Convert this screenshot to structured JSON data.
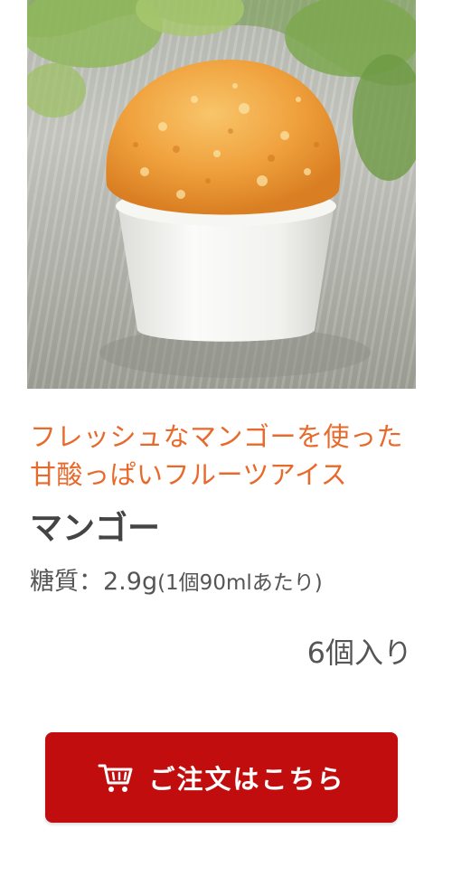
{
  "product": {
    "image_alt": "マンゴーアイス",
    "tagline": "フレッシュなマンゴーを使った甘酸っぱいフルーツアイス",
    "name": "マンゴー",
    "sugar_label": "糖質：",
    "sugar_value": "2.9g",
    "sugar_detail": "(1個90mlあたり)",
    "quantity": "6個入り"
  },
  "order_button": {
    "label": "ご注文はこちら",
    "icon": "cart-icon"
  },
  "colors": {
    "tagline": "#e8692a",
    "button": "#c10d0d"
  }
}
